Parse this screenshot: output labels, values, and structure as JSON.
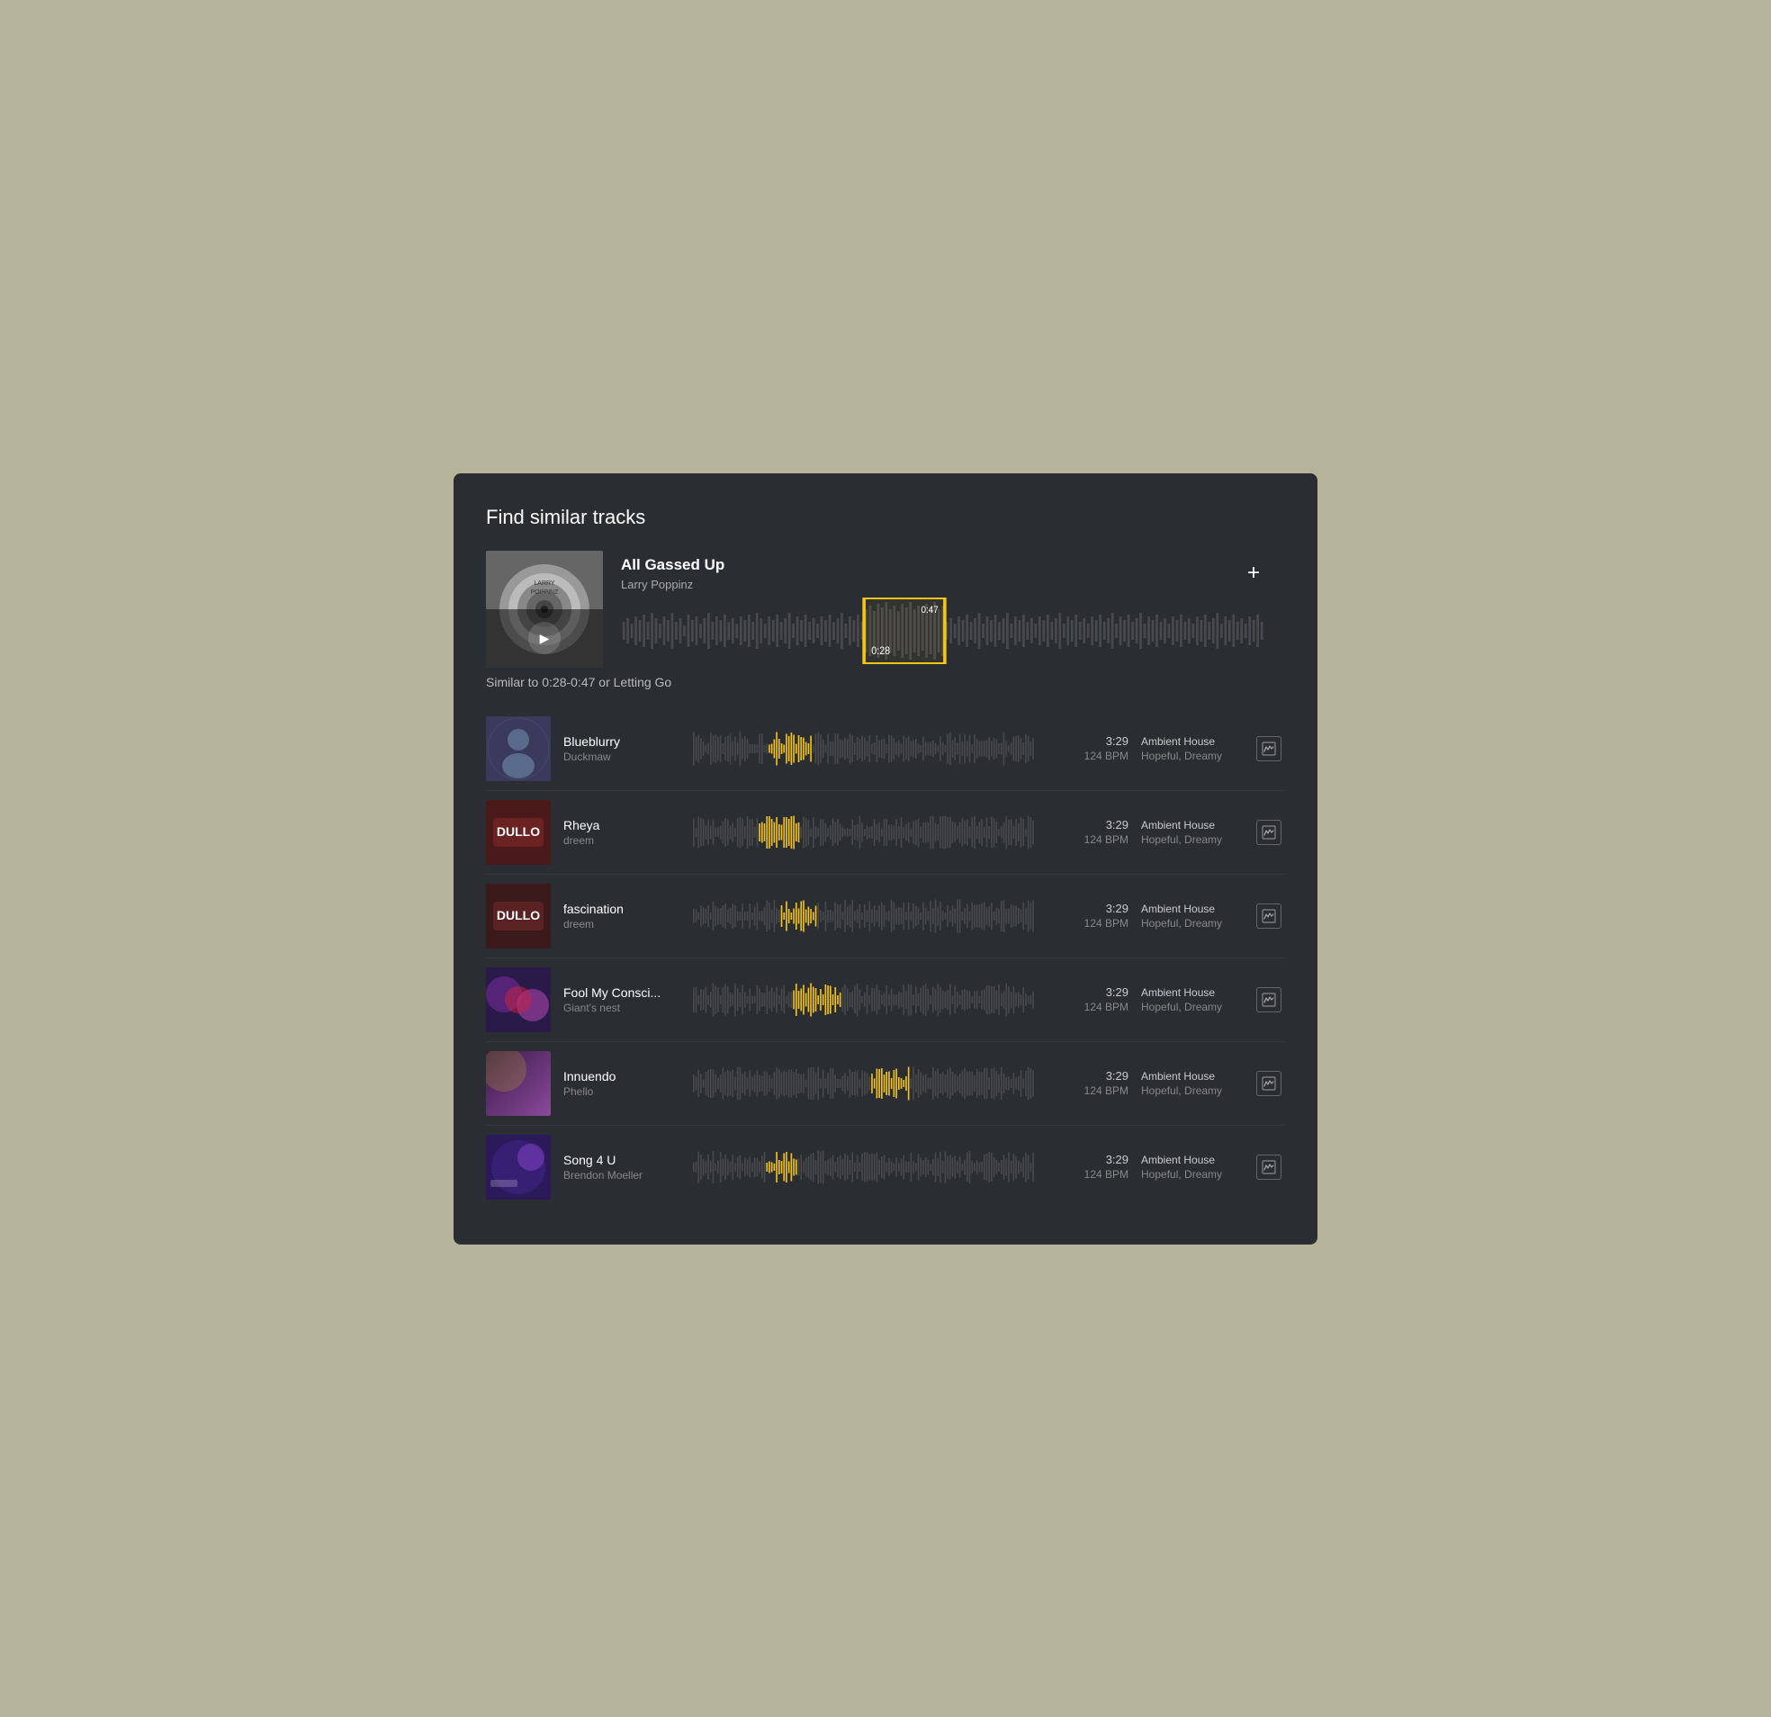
{
  "panel": {
    "title": "Find similar tracks"
  },
  "hero": {
    "title": "All Gassed Up",
    "artist": "Larry Poppinz",
    "add_label": "+",
    "play_label": "▶",
    "selection_end": "0:47",
    "selection_start": "0:28"
  },
  "similar_label": "Similar to 0:28-0:47 or Letting Go",
  "tracks": [
    {
      "name": "Blueblurry",
      "artist": "Duckmaw",
      "duration": "3:29",
      "bpm": "124 BPM",
      "genre": "Ambient House",
      "mood": "Hopeful, Dreamy",
      "highlight_pos": 0.15,
      "art_color1": "#3a3a5c",
      "art_color2": "#5a6a8c"
    },
    {
      "name": "Rheya",
      "artist": "dreem",
      "duration": "3:29",
      "bpm": "124 BPM",
      "genre": "Ambient House",
      "mood": "Hopeful, Dreamy",
      "highlight_pos": 0.12,
      "art_color1": "#4a1a1a",
      "art_color2": "#8a2a2a"
    },
    {
      "name": "fascination",
      "artist": "dreem",
      "duration": "3:29",
      "bpm": "124 BPM",
      "genre": "Ambient House",
      "mood": "Hopeful, Dreamy",
      "highlight_pos": 0.18,
      "art_color1": "#3a1a1a",
      "art_color2": "#7a2a2a"
    },
    {
      "name": "Fool My Consci...",
      "artist": "Giant's nest",
      "duration": "3:29",
      "bpm": "124 BPM",
      "genre": "Ambient House",
      "mood": "Hopeful, Dreamy",
      "highlight_pos": 0.22,
      "art_color1": "#2a1a4a",
      "art_color2": "#6a2a8a"
    },
    {
      "name": "Innuendo",
      "artist": "Phello",
      "duration": "3:29",
      "bpm": "124 BPM",
      "genre": "Ambient House",
      "mood": "Hopeful, Dreamy",
      "highlight_pos": 0.45,
      "art_color1": "#3a1a4a",
      "art_color2": "#8a4a9a"
    },
    {
      "name": "Song 4 U",
      "artist": "Brendon Moeller",
      "duration": "3:29",
      "bpm": "124 BPM",
      "genre": "Ambient House",
      "mood": "Hopeful, Dreamy",
      "highlight_pos": 0.14,
      "art_color1": "#2a1a5a",
      "art_color2": "#4a2a9a"
    }
  ]
}
